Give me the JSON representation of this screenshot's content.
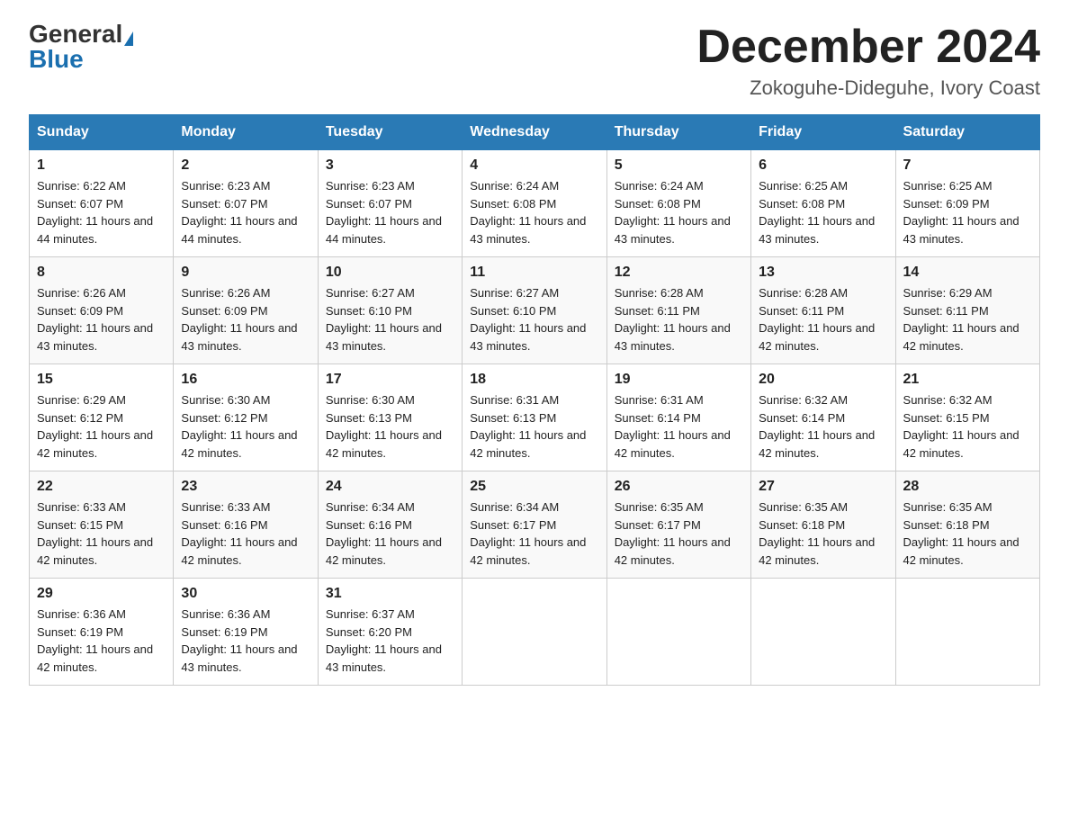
{
  "header": {
    "logo_general": "General",
    "logo_blue": "Blue",
    "month_title": "December 2024",
    "location": "Zokoguhe-Dideguhe, Ivory Coast"
  },
  "days_of_week": [
    "Sunday",
    "Monday",
    "Tuesday",
    "Wednesday",
    "Thursday",
    "Friday",
    "Saturday"
  ],
  "weeks": [
    [
      {
        "day": 1,
        "sunrise": "6:22 AM",
        "sunset": "6:07 PM",
        "daylight": "11 hours and 44 minutes."
      },
      {
        "day": 2,
        "sunrise": "6:23 AM",
        "sunset": "6:07 PM",
        "daylight": "11 hours and 44 minutes."
      },
      {
        "day": 3,
        "sunrise": "6:23 AM",
        "sunset": "6:07 PM",
        "daylight": "11 hours and 44 minutes."
      },
      {
        "day": 4,
        "sunrise": "6:24 AM",
        "sunset": "6:08 PM",
        "daylight": "11 hours and 43 minutes."
      },
      {
        "day": 5,
        "sunrise": "6:24 AM",
        "sunset": "6:08 PM",
        "daylight": "11 hours and 43 minutes."
      },
      {
        "day": 6,
        "sunrise": "6:25 AM",
        "sunset": "6:08 PM",
        "daylight": "11 hours and 43 minutes."
      },
      {
        "day": 7,
        "sunrise": "6:25 AM",
        "sunset": "6:09 PM",
        "daylight": "11 hours and 43 minutes."
      }
    ],
    [
      {
        "day": 8,
        "sunrise": "6:26 AM",
        "sunset": "6:09 PM",
        "daylight": "11 hours and 43 minutes."
      },
      {
        "day": 9,
        "sunrise": "6:26 AM",
        "sunset": "6:09 PM",
        "daylight": "11 hours and 43 minutes."
      },
      {
        "day": 10,
        "sunrise": "6:27 AM",
        "sunset": "6:10 PM",
        "daylight": "11 hours and 43 minutes."
      },
      {
        "day": 11,
        "sunrise": "6:27 AM",
        "sunset": "6:10 PM",
        "daylight": "11 hours and 43 minutes."
      },
      {
        "day": 12,
        "sunrise": "6:28 AM",
        "sunset": "6:11 PM",
        "daylight": "11 hours and 43 minutes."
      },
      {
        "day": 13,
        "sunrise": "6:28 AM",
        "sunset": "6:11 PM",
        "daylight": "11 hours and 42 minutes."
      },
      {
        "day": 14,
        "sunrise": "6:29 AM",
        "sunset": "6:11 PM",
        "daylight": "11 hours and 42 minutes."
      }
    ],
    [
      {
        "day": 15,
        "sunrise": "6:29 AM",
        "sunset": "6:12 PM",
        "daylight": "11 hours and 42 minutes."
      },
      {
        "day": 16,
        "sunrise": "6:30 AM",
        "sunset": "6:12 PM",
        "daylight": "11 hours and 42 minutes."
      },
      {
        "day": 17,
        "sunrise": "6:30 AM",
        "sunset": "6:13 PM",
        "daylight": "11 hours and 42 minutes."
      },
      {
        "day": 18,
        "sunrise": "6:31 AM",
        "sunset": "6:13 PM",
        "daylight": "11 hours and 42 minutes."
      },
      {
        "day": 19,
        "sunrise": "6:31 AM",
        "sunset": "6:14 PM",
        "daylight": "11 hours and 42 minutes."
      },
      {
        "day": 20,
        "sunrise": "6:32 AM",
        "sunset": "6:14 PM",
        "daylight": "11 hours and 42 minutes."
      },
      {
        "day": 21,
        "sunrise": "6:32 AM",
        "sunset": "6:15 PM",
        "daylight": "11 hours and 42 minutes."
      }
    ],
    [
      {
        "day": 22,
        "sunrise": "6:33 AM",
        "sunset": "6:15 PM",
        "daylight": "11 hours and 42 minutes."
      },
      {
        "day": 23,
        "sunrise": "6:33 AM",
        "sunset": "6:16 PM",
        "daylight": "11 hours and 42 minutes."
      },
      {
        "day": 24,
        "sunrise": "6:34 AM",
        "sunset": "6:16 PM",
        "daylight": "11 hours and 42 minutes."
      },
      {
        "day": 25,
        "sunrise": "6:34 AM",
        "sunset": "6:17 PM",
        "daylight": "11 hours and 42 minutes."
      },
      {
        "day": 26,
        "sunrise": "6:35 AM",
        "sunset": "6:17 PM",
        "daylight": "11 hours and 42 minutes."
      },
      {
        "day": 27,
        "sunrise": "6:35 AM",
        "sunset": "6:18 PM",
        "daylight": "11 hours and 42 minutes."
      },
      {
        "day": 28,
        "sunrise": "6:35 AM",
        "sunset": "6:18 PM",
        "daylight": "11 hours and 42 minutes."
      }
    ],
    [
      {
        "day": 29,
        "sunrise": "6:36 AM",
        "sunset": "6:19 PM",
        "daylight": "11 hours and 42 minutes."
      },
      {
        "day": 30,
        "sunrise": "6:36 AM",
        "sunset": "6:19 PM",
        "daylight": "11 hours and 43 minutes."
      },
      {
        "day": 31,
        "sunrise": "6:37 AM",
        "sunset": "6:20 PM",
        "daylight": "11 hours and 43 minutes."
      },
      null,
      null,
      null,
      null
    ]
  ]
}
